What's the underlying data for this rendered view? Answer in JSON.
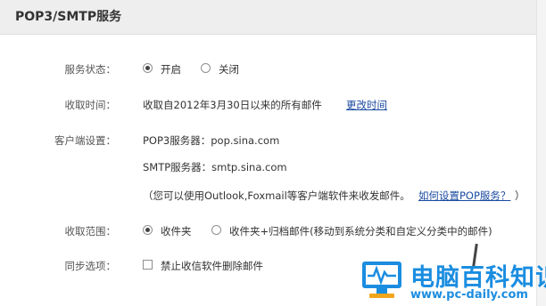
{
  "header": {
    "title": "POP3/SMTP服务"
  },
  "status": {
    "label": "服务状态：",
    "options": [
      {
        "label": "开启",
        "selected": true
      },
      {
        "label": "关闭",
        "selected": false
      }
    ]
  },
  "receive_time": {
    "label": "收取时间：",
    "value": "收取自2012年3月30日以来的所有邮件",
    "change_link": "更改时间"
  },
  "client": {
    "label": "客户端设置：",
    "pop3": "POP3服务器：pop.sina.com",
    "smtp": "SMTP服务器：smtp.sina.com",
    "note": "（您可以使用Outlook,Foxmail等客户端软件来收发邮件。",
    "help_link": "如何设置POP服务？",
    "note_end": "）"
  },
  "scope": {
    "label": "收取范围：",
    "options": [
      {
        "label": "收件夹",
        "selected": true
      },
      {
        "label": "收件夹+归档邮件(移动到系统分类和自定义分类中的邮件)",
        "selected": false
      }
    ]
  },
  "sync": {
    "label": "同步选项：",
    "checkbox_label": "禁止收信软件删除邮件",
    "checked": false
  },
  "watermark": {
    "name": "电脑百科知识",
    "url": "www.pc-daily.com"
  },
  "colors": {
    "link": "#1a4aa0",
    "header_bg": "#eeeeee",
    "watermark": "#1b8de0"
  }
}
